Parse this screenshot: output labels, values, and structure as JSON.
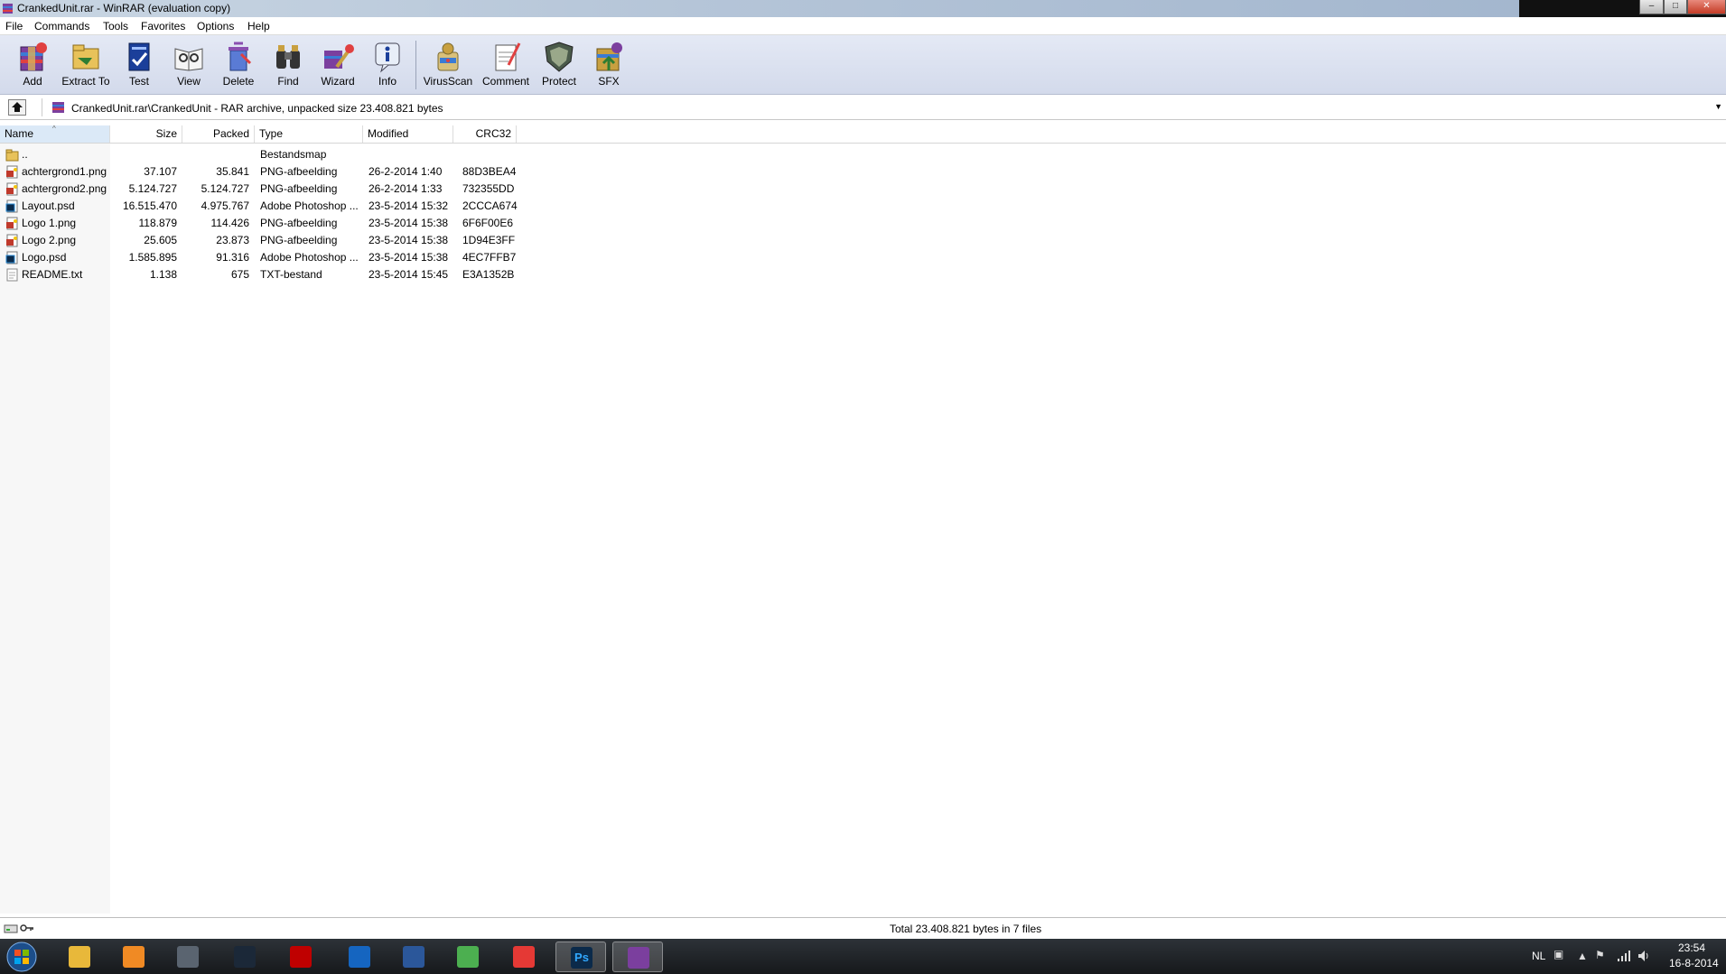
{
  "window": {
    "title": "CrankedUnit.rar - WinRAR (evaluation copy)",
    "min_glyph": "–",
    "max_glyph": "□",
    "close_glyph": "✕"
  },
  "menu": [
    "File",
    "Commands",
    "Tools",
    "Favorites",
    "Options",
    "Help"
  ],
  "toolbar": [
    {
      "label": "Add",
      "icon": "add-icon"
    },
    {
      "label": "Extract To",
      "icon": "extract-icon"
    },
    {
      "label": "Test",
      "icon": "test-icon"
    },
    {
      "label": "View",
      "icon": "view-icon"
    },
    {
      "label": "Delete",
      "icon": "delete-icon"
    },
    {
      "label": "Find",
      "icon": "find-icon"
    },
    {
      "label": "Wizard",
      "icon": "wizard-icon"
    },
    {
      "label": "Info",
      "icon": "info-icon"
    },
    {
      "label": "VirusScan",
      "icon": "virusscan-icon"
    },
    {
      "label": "Comment",
      "icon": "comment-icon"
    },
    {
      "label": "Protect",
      "icon": "protect-icon"
    },
    {
      "label": "SFX",
      "icon": "sfx-icon"
    }
  ],
  "address": {
    "path": "CrankedUnit.rar\\CrankedUnit - RAR archive, unpacked size 23.408.821 bytes",
    "dropdown_glyph": "▼"
  },
  "columns": {
    "name": "Name",
    "size": "Size",
    "packed": "Packed",
    "type": "Type",
    "modified": "Modified",
    "crc": "CRC32",
    "sort_glyph": "^"
  },
  "files": [
    {
      "name": "..",
      "size": "",
      "packed": "",
      "type": "Bestandsmap",
      "modified": "",
      "crc": "",
      "kind": "folder"
    },
    {
      "name": "achtergrond1.png",
      "size": "37.107",
      "packed": "35.841",
      "type": "PNG-afbeelding",
      "modified": "26-2-2014 1:40",
      "crc": "88D3BEA4",
      "kind": "png"
    },
    {
      "name": "achtergrond2.png",
      "size": "5.124.727",
      "packed": "5.124.727",
      "type": "PNG-afbeelding",
      "modified": "26-2-2014 1:33",
      "crc": "732355DD",
      "kind": "png"
    },
    {
      "name": "Layout.psd",
      "size": "16.515.470",
      "packed": "4.975.767",
      "type": "Adobe Photoshop ...",
      "modified": "23-5-2014 15:32",
      "crc": "2CCCA674",
      "kind": "psd"
    },
    {
      "name": "Logo 1.png",
      "size": "118.879",
      "packed": "114.426",
      "type": "PNG-afbeelding",
      "modified": "23-5-2014 15:38",
      "crc": "6F6F00E6",
      "kind": "png"
    },
    {
      "name": "Logo 2.png",
      "size": "25.605",
      "packed": "23.873",
      "type": "PNG-afbeelding",
      "modified": "23-5-2014 15:38",
      "crc": "1D94E3FF",
      "kind": "png"
    },
    {
      "name": "Logo.psd",
      "size": "1.585.895",
      "packed": "91.316",
      "type": "Adobe Photoshop ...",
      "modified": "23-5-2014 15:38",
      "crc": "4EC7FFB7",
      "kind": "psd"
    },
    {
      "name": "README.txt",
      "size": "1.138",
      "packed": "675",
      "type": "TXT-bestand",
      "modified": "23-5-2014 15:45",
      "crc": "E3A1352B",
      "kind": "txt"
    }
  ],
  "status": {
    "text": "Total 23.408.821 bytes in 7 files"
  },
  "taskbar": {
    "apps": [
      {
        "name": "explorer",
        "color": "#e8b83a"
      },
      {
        "name": "media-player",
        "color": "#f08a24"
      },
      {
        "name": "app-dark",
        "color": "#5a6470"
      },
      {
        "name": "steam",
        "color": "#1b2838"
      },
      {
        "name": "filezilla",
        "color": "#bf0000"
      },
      {
        "name": "outlook",
        "color": "#1565c0"
      },
      {
        "name": "word",
        "color": "#2b579a"
      },
      {
        "name": "chrome",
        "color": "#4caf50"
      },
      {
        "name": "pdf-reader",
        "color": "#e53935"
      },
      {
        "name": "photoshop",
        "color": "#0b2a4a"
      },
      {
        "name": "winrar",
        "color": "#7b3f9e"
      }
    ],
    "ps_label": "Ps",
    "lang": "NL",
    "time": "23:54",
    "date": "16-8-2014"
  },
  "colors": {
    "toolbar_bg": "#d3daeb",
    "sorted_col": "#dbe9f7",
    "taskbar": "#16181b"
  }
}
